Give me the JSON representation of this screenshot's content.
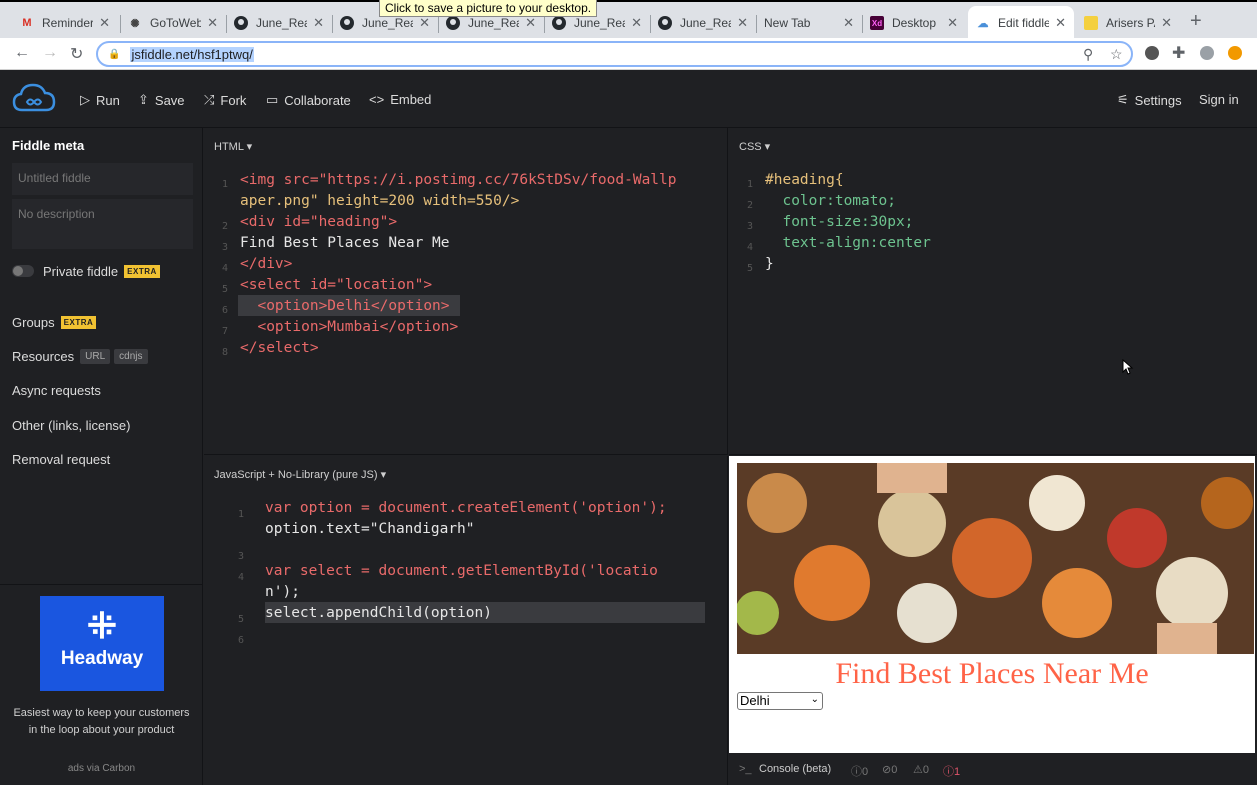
{
  "tooltip": "Click to save a picture to your desktop.",
  "tabs": [
    {
      "label": "Reminder",
      "icon": "gmail-icon"
    },
    {
      "label": "GoToWebin",
      "icon": "gotowebinar-icon"
    },
    {
      "label": "June_React",
      "icon": "github-icon"
    },
    {
      "label": "June_React",
      "icon": "github-icon"
    },
    {
      "label": "June_React",
      "icon": "github-icon"
    },
    {
      "label": "June_React",
      "icon": "github-icon"
    },
    {
      "label": "June_React",
      "icon": "github-icon"
    },
    {
      "label": "New Tab",
      "icon": ""
    },
    {
      "label": "Desktop",
      "icon": "xd-icon"
    },
    {
      "label": "Edit fiddle",
      "icon": "jsfiddle-icon"
    },
    {
      "label": "Arisers PA",
      "icon": "sticky-icon"
    }
  ],
  "address": {
    "url": "jsfiddle.net/hsf1ptwq/"
  },
  "toolbar": {
    "run": "Run",
    "save": "Save",
    "fork": "Fork",
    "collaborate": "Collaborate",
    "embed": "Embed",
    "settings": "Settings",
    "signin": "Sign in"
  },
  "sidebar": {
    "title": "Fiddle meta",
    "name_placeholder": "Untitled fiddle",
    "desc_placeholder": "No description",
    "private_label": "Private fiddle",
    "extra": "EXTRA",
    "groups": "Groups",
    "resources": "Resources",
    "url_tag": "URL",
    "cdnjs_tag": "cdnjs",
    "async": "Async requests",
    "other": "Other (links, license)",
    "removal": "Removal request"
  },
  "ad": {
    "brand": "Headway",
    "text": "Easiest way to keep your customers in the loop about your product",
    "via": "ads via Carbon"
  },
  "panels": {
    "html": "HTML ▾",
    "css": "CSS ▾",
    "js": "JavaScript + No-Library (pure JS) ▾"
  },
  "html_code": {
    "line1a": "<img src=\"https://i.postimg.cc/76kStDSv/food-Wallp",
    "line1b": "aper.png\" height=200 width=550/>",
    "line2": "<div id=\"heading\">",
    "line3": "Find Best Places Near Me",
    "line4": "</div>",
    "line5": "<select id=\"location\">",
    "line6": "  <option>Delhi</option>",
    "line7": "  <option>Mumbai</option>",
    "line8": "</select>"
  },
  "css_code": {
    "line1": "#heading{",
    "line2": "  color:tomato;",
    "line3": "  font-size:30px;",
    "line4": "  text-align:center",
    "line5": "}"
  },
  "js_code": {
    "line1": "var option = document.createElement('option');",
    "line2": "option.text=\"Chandigarh\"",
    "line4a": "var select = document.getElementById('locatio",
    "line4b": "n');",
    "line5": "select.appendChild(option)"
  },
  "result": {
    "heading": "Find Best Places Near Me",
    "selected": "Delhi"
  },
  "console": {
    "label": "Console (beta)",
    "info": "0",
    "log": "0",
    "warn": "0",
    "error": "1"
  }
}
